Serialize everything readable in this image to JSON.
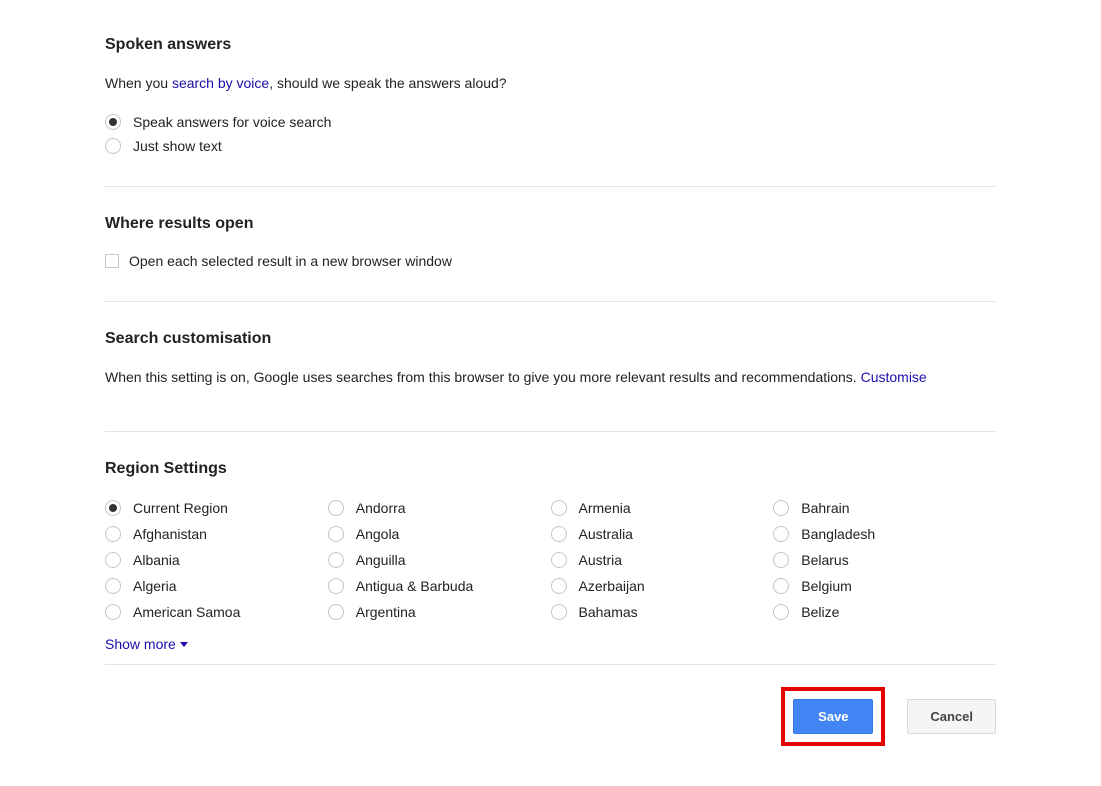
{
  "spoken": {
    "title": "Spoken answers",
    "desc_prefix": "When you ",
    "desc_link": "search by voice",
    "desc_suffix": ", should we speak the answers aloud?",
    "opt_speak": "Speak answers for voice search",
    "opt_text": "Just show text"
  },
  "results_open": {
    "title": "Where results open",
    "checkbox_label": "Open each selected result in a new browser window"
  },
  "search_custom": {
    "title": "Search customisation",
    "desc": "When this setting is on, Google uses searches from this browser to give you more relevant results and recommendations. ",
    "link": "Customise"
  },
  "region": {
    "title": "Region Settings",
    "show_more": "Show more",
    "items": [
      "Current Region",
      "Afghanistan",
      "Albania",
      "Algeria",
      "American Samoa",
      "Andorra",
      "Angola",
      "Anguilla",
      "Antigua & Barbuda",
      "Argentina",
      "Armenia",
      "Australia",
      "Austria",
      "Azerbaijan",
      "Bahamas",
      "Bahrain",
      "Bangladesh",
      "Belarus",
      "Belgium",
      "Belize"
    ]
  },
  "buttons": {
    "save": "Save",
    "cancel": "Cancel"
  }
}
